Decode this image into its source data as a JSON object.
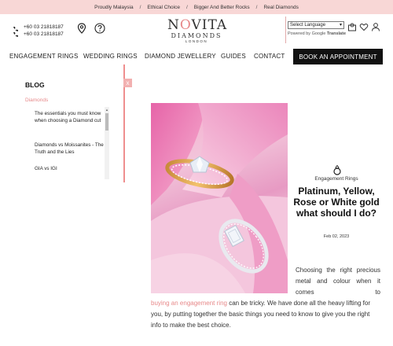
{
  "promo": {
    "items": [
      "Proudly Malaysia",
      "Ethical Choice",
      "Bigger And Better Rocks",
      "Real Diamonds"
    ],
    "separator": "/"
  },
  "header": {
    "phone1": "+60 03 21818187",
    "phone2": "+60 03 21818187",
    "logo_line1_a": "N",
    "logo_line1_o": "O",
    "logo_line1_b": "VITA",
    "logo_line2": "DIAMONDS",
    "logo_line3": "LONDON",
    "language_select": "Select Language",
    "powered_by": "Powered by",
    "google": "Google",
    "translate": "Translate"
  },
  "nav": {
    "items": [
      "ENGAGEMENT RINGS",
      "WEDDING RINGS",
      "DIAMOND JEWELLERY",
      "GUIDES",
      "CONTACT"
    ],
    "book_button": "BOOK AN APPOINTMENT"
  },
  "sidebar": {
    "title": "BLOG",
    "close": "x",
    "category": "Diamonds",
    "posts": [
      "The essentials you must know when choosing a Diamond cut",
      "Diamonds vs Moissanites - The Truth and the Lies",
      "GIA vs IGI"
    ]
  },
  "article": {
    "category": "Engagement Rings",
    "title": "Platinum, Yellow, Rose or White gold what should I do?",
    "date": "Feb 02, 2023",
    "para_1": "Choosing the right precious metal and colour when it comes to",
    "link": "buying an engagement ring",
    "para_2": "can be tricky. We have done all the heavy lifting for you, by putting together the basic things you need to know to give you the right info to make the best choice."
  },
  "colors": {
    "promo_bg": "#f8d7d6",
    "accent_pink": "#e7898a",
    "button_black": "#111111"
  }
}
